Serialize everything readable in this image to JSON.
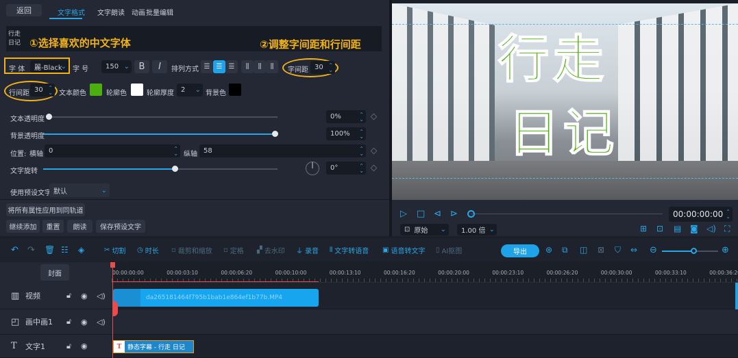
{
  "header": {
    "back": "返回",
    "tabs": [
      "文字格式",
      "文字朗读",
      "动画",
      "批量编辑"
    ],
    "active_tab": 0
  },
  "preview_text": {
    "line1": "行走",
    "line2": "日记"
  },
  "annotations": {
    "a1": "①选择喜欢的中文字体",
    "a2": "②调整字间距和行间距"
  },
  "format": {
    "font_label": "字 体",
    "font_value": "麗-Black",
    "size_label": "字 号",
    "size_value": "150",
    "bold": "B",
    "italic": "I",
    "arrange_label": "排列方式",
    "spacing_label": "字间距",
    "spacing_value": "30",
    "line_label": "行间距",
    "line_value": "30",
    "text_color_label": "文本颜色",
    "text_color": "#4caf10",
    "outline_label": "轮廓色",
    "outline_color": "#ffffff",
    "outline_width_label": "轮廓厚度",
    "outline_width": "2",
    "bg_label": "背景色",
    "bg_color": "#000000"
  },
  "props": {
    "text_opacity_label": "文本透明度",
    "text_opacity": "0%",
    "text_opacity_value": 0,
    "bg_opacity_label": "背景透明度",
    "bg_opacity": "100%",
    "bg_opacity_value": 100,
    "pos_label": "位置:",
    "x_label": "横轴",
    "x_value": "0",
    "y_label": "纵轴",
    "y_value": "58",
    "rotate_label": "文字旋转",
    "rotate_value": "0°",
    "rotate_fraction": 0.5,
    "preset_label": "使用预设文字",
    "preset_value": "默认"
  },
  "actions": {
    "apply_all": "将所有属性应用到同轨道",
    "continue_add": "继续添加",
    "reset": "重置",
    "read": "朗读",
    "save_preset": "保存预设文字"
  },
  "player": {
    "time": "00:00:00:00",
    "ratio": "原始",
    "speed": "1.00 倍"
  },
  "toolbar": {
    "cut": "切割",
    "duration": "时长",
    "crop": "裁剪和缩放",
    "freeze": "定格",
    "mosaic": "去水印",
    "record": "录音",
    "tts": "文字转语音",
    "stt": "语音转文字",
    "ai": "AI抠图",
    "export": "导出"
  },
  "timeline": {
    "cover": "封面",
    "ticks": [
      "00:00:00:00",
      "00:00:03:10",
      "00:00:06:20",
      "00:00:10:00",
      "00:00:13:10",
      "00:00:16:20",
      "00:00:20:00",
      "00:00:23:10",
      "00:00:26:20",
      "00:00:30:00",
      "00:00:33:10",
      "00:00:36:20"
    ],
    "tracks": [
      {
        "name": "视频",
        "icon": "film-icon"
      },
      {
        "name": "画中画1",
        "icon": "pip-icon"
      },
      {
        "name": "文字1",
        "icon": "text-icon"
      }
    ],
    "video_clip": "da265181464f795b1bab1e864ef1b77b.MP4",
    "text_clip": "静态字幕 - 行走 日记"
  },
  "colors": {
    "accent": "#2aa6e6",
    "annotation": "#f2b318",
    "playhead": "#e84c4c"
  }
}
